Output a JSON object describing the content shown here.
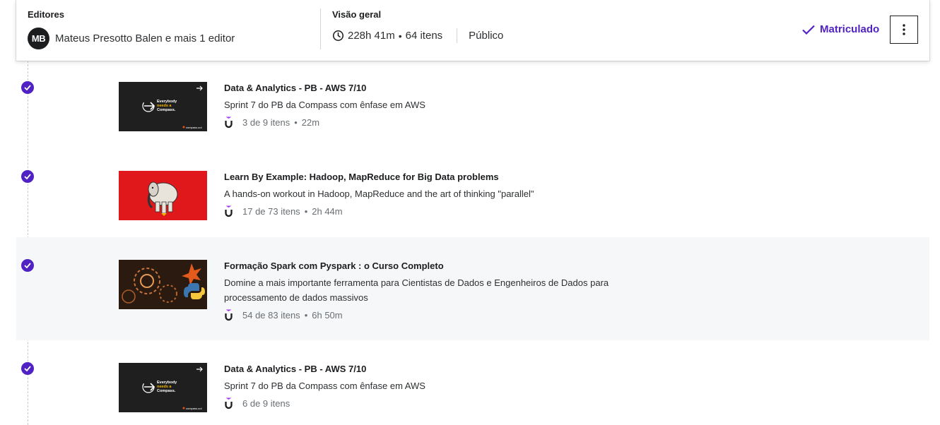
{
  "header": {
    "editors_title": "Editores",
    "avatar_initials": "MB",
    "editors_text": "Mateus Presotto Balen e mais 1 editor",
    "overview_title": "Visão geral",
    "duration": "228h 41m",
    "bullet": "•",
    "items_count": "64 itens",
    "visibility": "Público",
    "enrolled_label": "Matriculado"
  },
  "colors": {
    "accent": "#5022c3",
    "highlight": "#f6f7f9"
  },
  "icons": [
    "clock-icon",
    "check-icon",
    "kebab-menu-icon",
    "completed-check-icon",
    "udemy-logo-icon"
  ],
  "courses": [
    {
      "title": "Data & Analytics - PB - AWS 7/10",
      "description": "Sprint 7 do PB da Compass com ênfase em AWS",
      "progress": "3 de 9 itens",
      "separator": "•",
      "duration": "22m",
      "thumb_text": [
        "Everybody",
        "needs a",
        "Compass."
      ],
      "thumb_brand": "compass.uol"
    },
    {
      "title": "Learn By Example: Hadoop, MapReduce for Big Data problems",
      "description": "A hands-on workout in Hadoop, MapReduce and the art of thinking \"parallel\"",
      "progress": "17 de 73 itens",
      "separator": "•",
      "duration": "2h 44m"
    },
    {
      "title": "Formação Spark com Pyspark : o Curso Completo",
      "description": "Domine a mais importante ferramenta para Cientistas de Dados e Engenheiros de Dados para processamento de dados massivos",
      "progress": "54 de 83 itens",
      "separator": "•",
      "duration": "6h 50m"
    },
    {
      "title": "Data & Analytics - PB - AWS 7/10",
      "description": "Sprint 7 do PB da Compass com ênfase em AWS",
      "progress": "6 de 9 itens",
      "thumb_text": [
        "Everybody",
        "needs a",
        "Compass."
      ],
      "thumb_brand": "compass.uol"
    }
  ]
}
